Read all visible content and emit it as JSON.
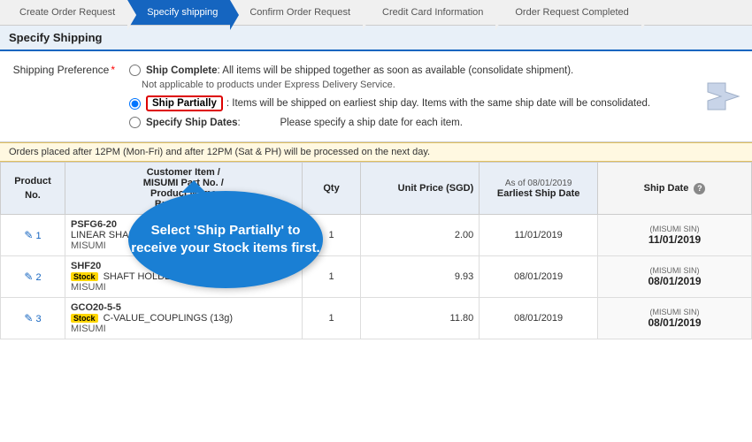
{
  "wizard": {
    "steps": [
      {
        "label": "Create Order Request",
        "active": false
      },
      {
        "label": "Specify shipping",
        "active": true
      },
      {
        "label": "Confirm Order Request",
        "active": false
      },
      {
        "label": "Credit Card Information",
        "active": false
      },
      {
        "label": "Order Request Completed",
        "active": false
      }
    ]
  },
  "page_title": "Specify Shipping",
  "shipping": {
    "label": "Shipping Preference",
    "required": "*",
    "options": [
      {
        "id": "opt1",
        "label": "Ship Complete",
        "desc": ": All items will be shipped together as soon as available (consolidate shipment). Not applicable to products under Express Delivery Service.",
        "selected": false,
        "highlighted": false
      },
      {
        "id": "opt2",
        "label": "Ship Partially",
        "desc": ": Items will be shipped on earliest ship day. Items with the same ship date will be consolidated.",
        "selected": true,
        "highlighted": true
      },
      {
        "id": "opt3",
        "label": "Specify Ship Dates",
        "desc": ": Please specify a ship date for each item.",
        "selected": false,
        "highlighted": false
      }
    ]
  },
  "tooltip": {
    "text": "Select 'Ship Partially' to receive your Stock items first."
  },
  "notice": "Orders placed after 12PM (Mon-Fri) and after 12PM (Sat & PH) will be processed on the next day.",
  "table": {
    "headers": {
      "no": "No.",
      "customer_item": "Customer Item /\nMISUMI Part No. /\nProduct Name\nBrand Name",
      "qty": "Qty",
      "unit_price": "Unit Price (SGD)",
      "earliest_ship_date": "As of 08/01/2019\nEarliest Ship Date",
      "ship_date": "Ship Date"
    },
    "rows": [
      {
        "no": "1",
        "part_no": "PSFG6-20",
        "product_name": "LINEAR SHAFT (5g)",
        "brand": "MISUMI",
        "stock": false,
        "qty": "1",
        "unit_price": "2.00",
        "earliest_ship_date": "11/01/2019",
        "ship_date_sub": "(MISUMI SIN)",
        "ship_date": "11/01/2019"
      },
      {
        "no": "2",
        "part_no": "SHF20",
        "product_name": "SHAFT HOLDER  (39g)",
        "brand": "MISUMI",
        "stock": true,
        "qty": "1",
        "unit_price": "9.93",
        "earliest_ship_date": "08/01/2019",
        "ship_date_sub": "(MISUMI SIN)",
        "ship_date": "08/01/2019"
      },
      {
        "no": "3",
        "part_no": "GCO20-5-5",
        "product_name": "C-VALUE_COUPLINGS  (13g)",
        "brand": "MISUMI",
        "stock": true,
        "qty": "1",
        "unit_price": "11.80",
        "earliest_ship_date": "08/01/2019",
        "ship_date_sub": "(MISUMI SIN)",
        "ship_date": "08/01/2019"
      }
    ],
    "stock_label": "Stock"
  }
}
